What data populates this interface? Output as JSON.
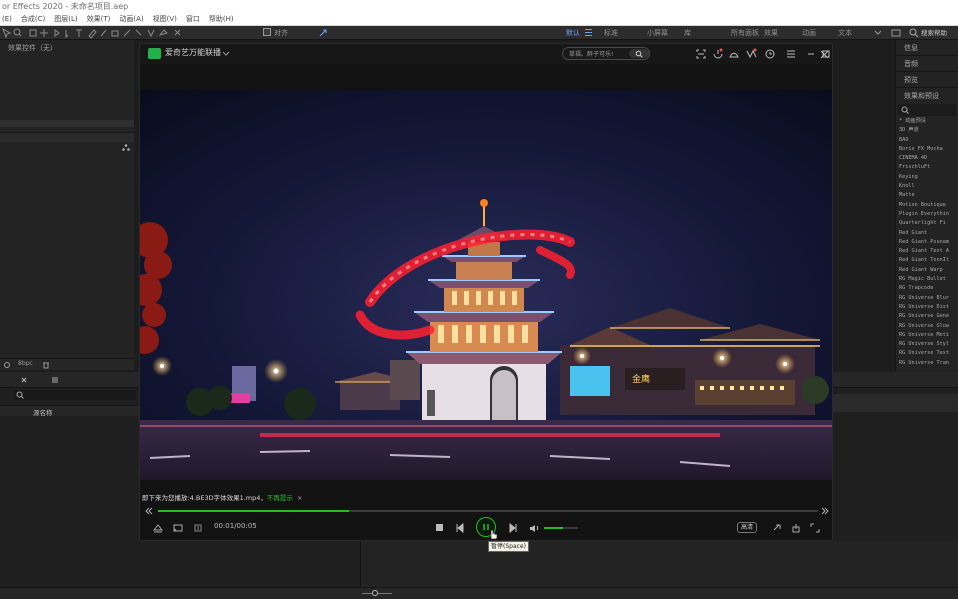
{
  "app": {
    "title": "or Effects 2020 - 未命名项目.aep"
  },
  "menu": [
    "(E)",
    "合成(C)",
    "图层(L)",
    "效果(T)",
    "动画(A)",
    "视图(V)",
    "窗口",
    "帮助(H)"
  ],
  "toolbar": {
    "align_label": "对齐",
    "workspaces": [
      "默认",
      "标准",
      "小屏幕",
      "库",
      "所有面板",
      "效果",
      "动画",
      "文本"
    ],
    "search_placeholder": "搜索帮助"
  },
  "left_panel": {
    "title": "效果控件（无）",
    "bpc": "8bpc"
  },
  "right_panel": {
    "tabs": [
      "信息",
      "音频",
      "预览",
      "效果和预设"
    ],
    "effects": [
      "* 动画预设",
      "3D 声道",
      "BAO",
      "Boris FX Mocha",
      "CINEMA 4D",
      "FrischluFt",
      "Keying",
      "Knoll",
      "Matte",
      "Motion Boutique",
      "Plugin Everythin",
      "Quarterlight Fi",
      "Red Giant",
      "Red Giant Psunam",
      "Red Giant Text A",
      "Red Giant ToonIt",
      "Red Giant Warp",
      "RG Magic Bullet",
      "RG Trapcode",
      "RG Universe Blur",
      "RG Universe Dist",
      "RG Universe Gene",
      "RG Universe Glow",
      "RG Universe Moti",
      "RG Universe Styl",
      "RG Universe Text",
      "RG Universe Tran"
    ]
  },
  "timeline": {
    "label": "源名称"
  },
  "player": {
    "app_name": "爱奇艺万能联播",
    "search_placeholder": "草福、醉子可乐!",
    "next_notice": "即下来为您播放:4.BE3D字体效果1.mp4，",
    "next_notice_action": "不再提示",
    "time_current": "00:01",
    "time_total": "00:05",
    "time_sep": "/",
    "progress": 0.29,
    "volume": 0.55,
    "quality_label": "高清",
    "pause_tooltip": "暂停(Space)"
  },
  "colors": {
    "accent_green": "#20c020"
  }
}
